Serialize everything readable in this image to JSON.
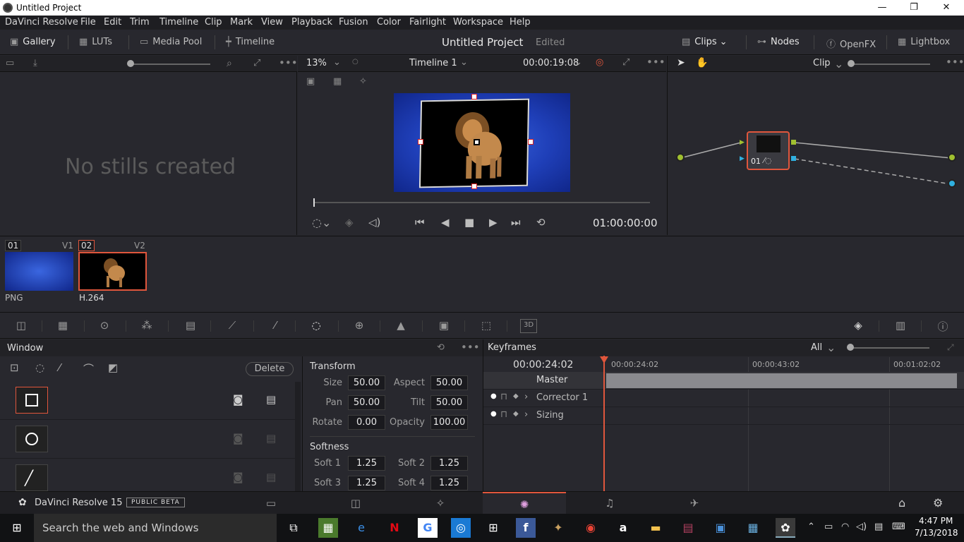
{
  "window": {
    "title": "Untitled Project",
    "min": "—",
    "max": "❐",
    "close": "✕"
  },
  "menu": [
    "DaVinci Resolve",
    "File",
    "Edit",
    "Trim",
    "Timeline",
    "Clip",
    "Mark",
    "View",
    "Playback",
    "Fusion",
    "Color",
    "Fairlight",
    "Workspace",
    "Help"
  ],
  "toolbar": {
    "gallery": "Gallery",
    "luts": "LUTs",
    "media_pool": "Media Pool",
    "timeline": "Timeline",
    "project": "Untitled Project",
    "edited": "Edited",
    "clips": "Clips",
    "nodes": "Nodes",
    "openfx": "OpenFX",
    "lightbox": "Lightbox"
  },
  "gallery": {
    "empty": "No stills created"
  },
  "viewer": {
    "zoom": "13%",
    "timeline": "Timeline 1",
    "header_tc": "00:00:19:08",
    "timecode": "01:00:00:00"
  },
  "nodes": {
    "mode": "Clip",
    "node_label": "01"
  },
  "clips": [
    {
      "num": "01",
      "track": "V1",
      "codec": "PNG",
      "color": "#2a48c8"
    },
    {
      "num": "02",
      "track": "V2",
      "codec": "H.264",
      "color": "#000000"
    }
  ],
  "window_panel": {
    "title": "Window",
    "delete": "Delete"
  },
  "transform": {
    "title": "Transform",
    "size_label": "Size",
    "size": "50.00",
    "aspect_label": "Aspect",
    "aspect": "50.00",
    "pan_label": "Pan",
    "pan": "50.00",
    "tilt_label": "Tilt",
    "tilt": "50.00",
    "rotate_label": "Rotate",
    "rotate": "0.00",
    "opacity_label": "Opacity",
    "opacity": "100.00",
    "softness_title": "Softness",
    "soft1_label": "Soft 1",
    "soft1": "1.25",
    "soft2_label": "Soft 2",
    "soft2": "1.25",
    "soft3_label": "Soft 3",
    "soft3": "1.25",
    "soft4_label": "Soft 4",
    "soft4": "1.25"
  },
  "keyframes": {
    "title": "Keyframes",
    "filter": "All",
    "current": "00:00:24:02",
    "ruler": [
      "00:00:24:02",
      "00:00:43:02",
      "00:01:02:02"
    ],
    "master": "Master",
    "rows": [
      "Corrector 1",
      "Sizing"
    ]
  },
  "footer": {
    "app": "DaVinci Resolve 15",
    "badge": "PUBLIC BETA"
  },
  "taskbar": {
    "search": "Search the web and Windows",
    "time": "4:47 PM",
    "date": "7/13/2018"
  },
  "colors": {
    "accent": "#e0563c",
    "selected_clip": "#e0563c"
  }
}
